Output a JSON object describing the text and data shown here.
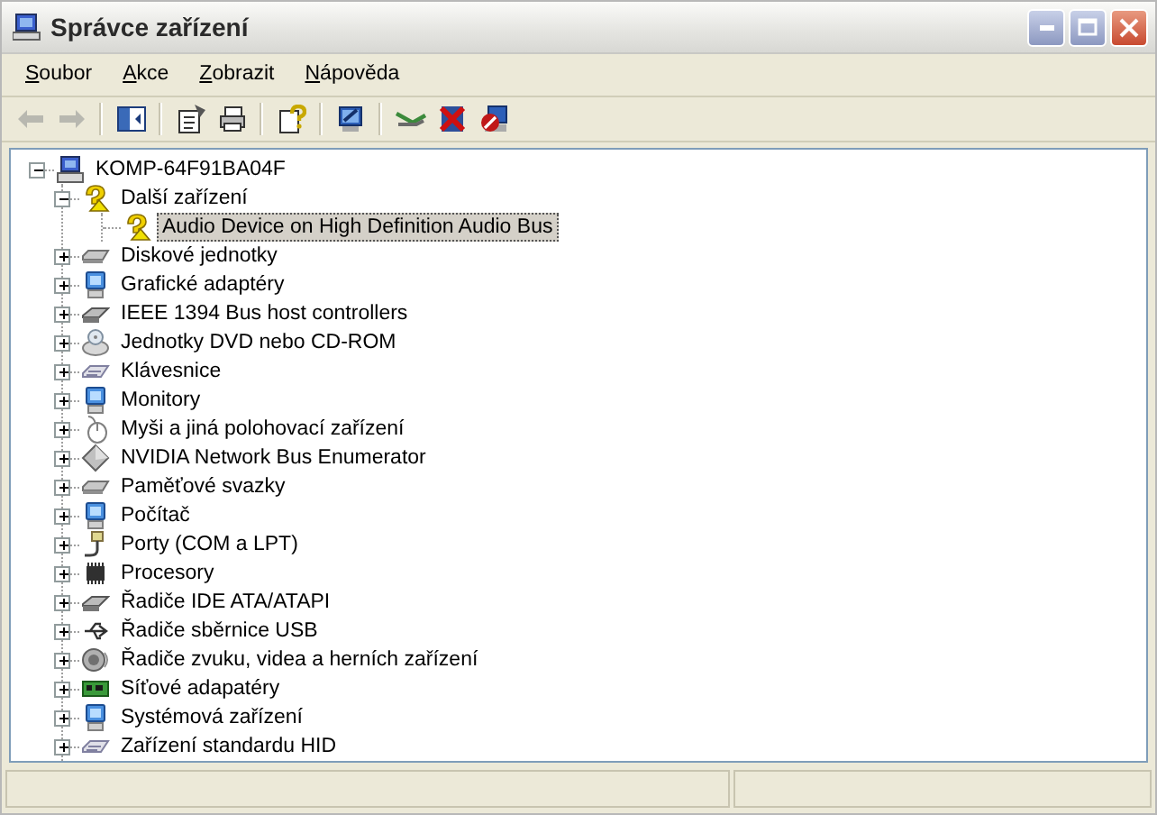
{
  "window": {
    "title": "Správce zařízení"
  },
  "menu": [
    {
      "label": "Soubor"
    },
    {
      "label": "Akce"
    },
    {
      "label": "Zobrazit"
    },
    {
      "label": "Nápověda"
    }
  ],
  "toolbar": [
    {
      "kind": "back",
      "disabled": true
    },
    {
      "kind": "forward",
      "disabled": true
    },
    {
      "kind": "separator"
    },
    {
      "kind": "console-tree",
      "disabled": false
    },
    {
      "kind": "separator"
    },
    {
      "kind": "properties",
      "disabled": false
    },
    {
      "kind": "print",
      "disabled": false
    },
    {
      "kind": "separator"
    },
    {
      "kind": "help",
      "disabled": false
    },
    {
      "kind": "separator"
    },
    {
      "kind": "scan",
      "disabled": false
    },
    {
      "kind": "separator"
    },
    {
      "kind": "update",
      "disabled": false
    },
    {
      "kind": "uninstall",
      "disabled": false
    },
    {
      "kind": "disable",
      "disabled": false
    }
  ],
  "tree": {
    "label": "KOMP-64F91BA04F",
    "expanded": true,
    "selected": false,
    "children": [
      {
        "label": "Další zařízení",
        "expanded": true,
        "selected": false,
        "warning": true,
        "children": [
          {
            "label": "Audio Device on High Definition Audio Bus",
            "selected": true,
            "warning": true
          }
        ]
      },
      {
        "label": "Diskové jednotky",
        "expanded": false,
        "selected": false,
        "warning": false
      },
      {
        "label": "Grafické adaptéry",
        "expanded": false,
        "selected": false,
        "warning": false
      },
      {
        "label": "IEEE 1394 Bus host controllers",
        "expanded": false,
        "selected": false,
        "warning": false
      },
      {
        "label": "Jednotky DVD nebo CD-ROM",
        "expanded": false,
        "selected": false,
        "warning": false
      },
      {
        "label": "Klávesnice",
        "expanded": false,
        "selected": false,
        "warning": false
      },
      {
        "label": "Monitory",
        "expanded": false,
        "selected": false,
        "warning": false
      },
      {
        "label": "Myši a jiná polohovací zařízení",
        "expanded": false,
        "selected": false,
        "warning": false
      },
      {
        "label": "NVIDIA Network Bus Enumerator",
        "expanded": false,
        "selected": false,
        "warning": false
      },
      {
        "label": "Paměťové svazky",
        "expanded": false,
        "selected": false,
        "warning": false
      },
      {
        "label": "Počítač",
        "expanded": false,
        "selected": false,
        "warning": false
      },
      {
        "label": "Porty (COM a LPT)",
        "expanded": false,
        "selected": false,
        "warning": false
      },
      {
        "label": "Procesory",
        "expanded": false,
        "selected": false,
        "warning": false
      },
      {
        "label": "Řadiče IDE ATA/ATAPI",
        "expanded": false,
        "selected": false,
        "warning": false
      },
      {
        "label": "Řadiče sběrnice USB",
        "expanded": false,
        "selected": false,
        "warning": false
      },
      {
        "label": "Řadiče zvuku, videa a herních zařízení",
        "expanded": false,
        "selected": false,
        "warning": false
      },
      {
        "label": "Síťové adapatéry",
        "expanded": false,
        "selected": false,
        "warning": false
      },
      {
        "label": "Systémová zařízení",
        "expanded": false,
        "selected": false,
        "warning": false
      },
      {
        "label": "Zařízení standardu HID",
        "expanded": false,
        "selected": false,
        "warning": false
      }
    ]
  }
}
